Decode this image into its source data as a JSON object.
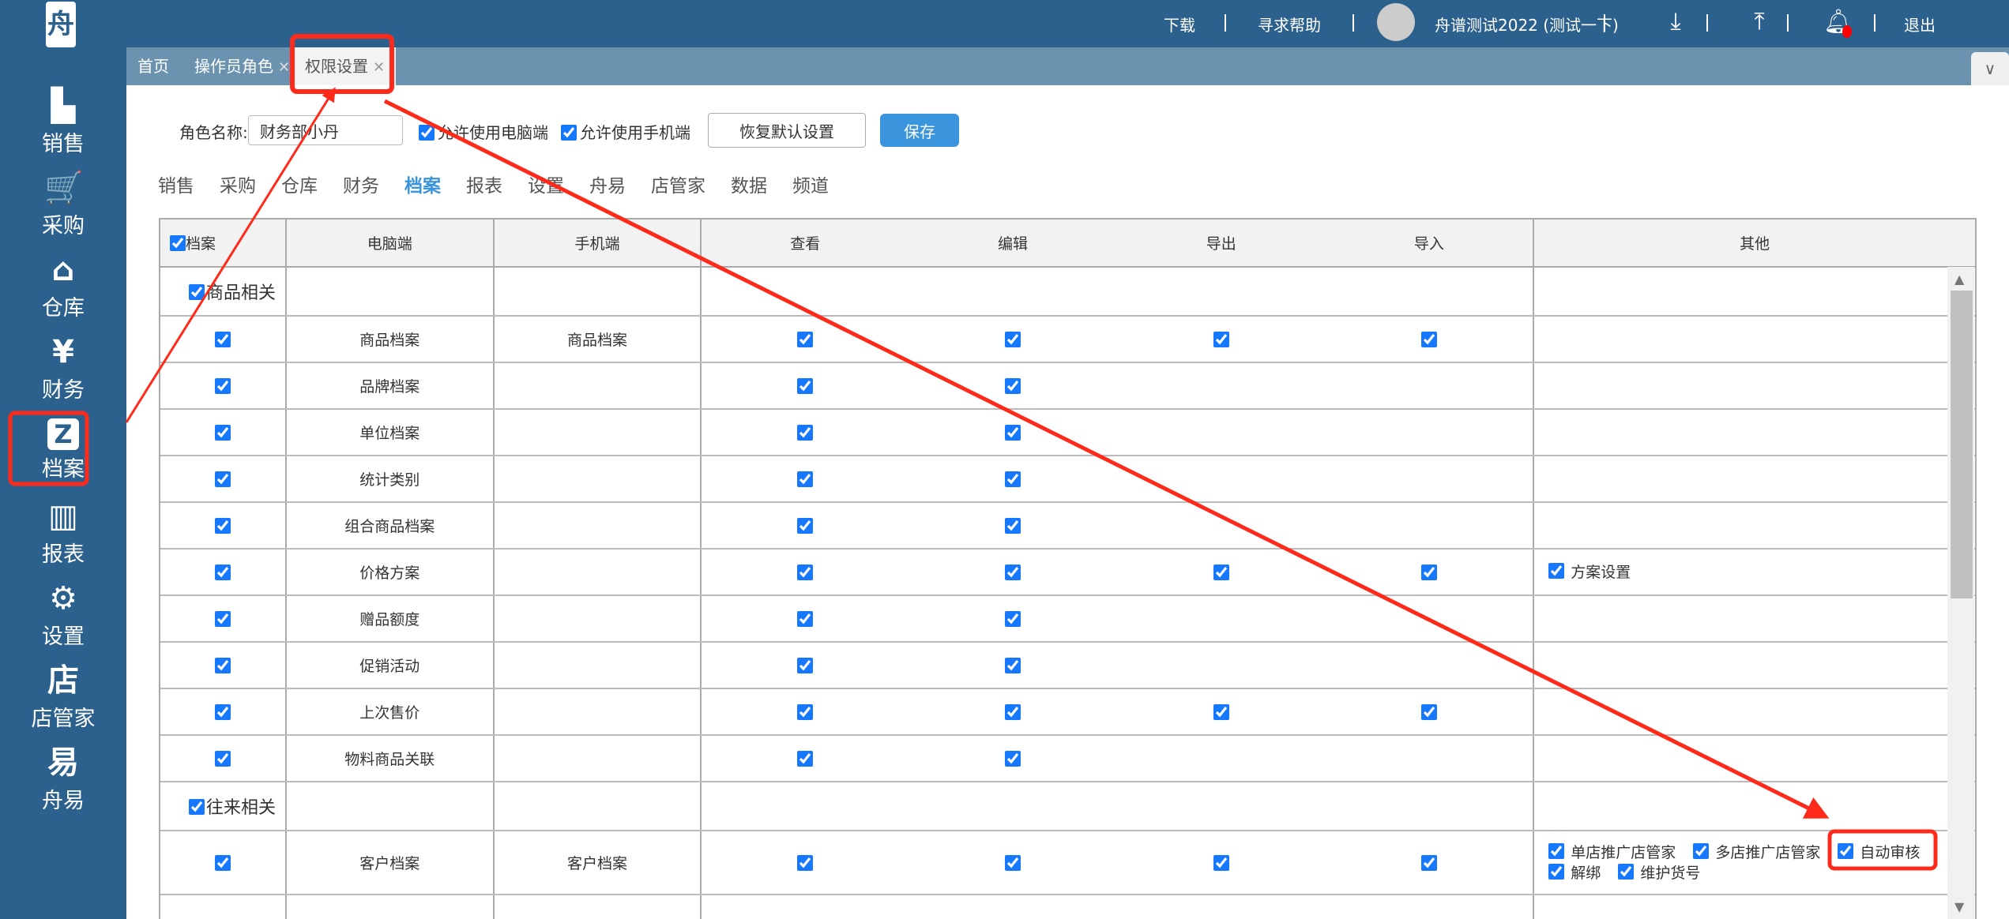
{
  "app": {
    "logo_text": "舟"
  },
  "topbar": {
    "download": "下载",
    "help": "寻求帮助",
    "user": "舟谱测试2022 (测试一下)",
    "logout": "退出",
    "notification_dot_color": "#ff0000"
  },
  "sidebar": {
    "active": "档案",
    "items": [
      {
        "label": "销售",
        "icon": "sales-chart-icon",
        "glyph": "▙"
      },
      {
        "label": "采购",
        "icon": "cart-icon",
        "glyph": "🛒"
      },
      {
        "label": "仓库",
        "icon": "warehouse-icon",
        "glyph": "⌂"
      },
      {
        "label": "财务",
        "icon": "yen-icon",
        "glyph": "¥"
      },
      {
        "label": "档案",
        "icon": "archive-z-icon",
        "glyph": "Z"
      },
      {
        "label": "报表",
        "icon": "report-bars-icon",
        "glyph": "▥"
      },
      {
        "label": "设置",
        "icon": "gear-icon",
        "glyph": "⚙"
      },
      {
        "label": "店管家",
        "icon": "store-icon",
        "glyph": "店"
      },
      {
        "label": "舟易",
        "icon": "zhouyi-icon",
        "glyph": "易"
      }
    ]
  },
  "tabs": [
    {
      "label": "首页",
      "closable": false
    },
    {
      "label": "操作员角色",
      "closable": true
    },
    {
      "label": "权限设置",
      "closable": true,
      "active": true
    }
  ],
  "form": {
    "role_label": "角色名称:",
    "role_value": "财务部小丹",
    "allow_pc": {
      "label": "允许使用电脑端",
      "checked": true
    },
    "allow_mobile": {
      "label": "允许使用手机端",
      "checked": true
    },
    "reset_label": "恢复默认设置",
    "save_label": "保存"
  },
  "categories": [
    "销售",
    "采购",
    "仓库",
    "财务",
    "档案",
    "报表",
    "设置",
    "舟易",
    "店管家",
    "数据",
    "频道"
  ],
  "active_category": "档案",
  "table": {
    "headers": {
      "all": "档案",
      "pc": "电脑端",
      "mobile": "手机端",
      "view": "查看",
      "edit": "编辑",
      "export": "导出",
      "import": "导入",
      "other": "其他"
    },
    "header_all_checked": true,
    "groups": [
      {
        "label": "商品相关",
        "checked": true,
        "rows": [
          {
            "pc": "商品档案",
            "mobile": "商品档案",
            "view": true,
            "edit": true,
            "export": true,
            "import": true,
            "other": []
          },
          {
            "pc": "品牌档案",
            "mobile": "",
            "view": true,
            "edit": true,
            "export": false,
            "import": false,
            "other": []
          },
          {
            "pc": "单位档案",
            "mobile": "",
            "view": true,
            "edit": true,
            "export": false,
            "import": false,
            "other": []
          },
          {
            "pc": "统计类别",
            "mobile": "",
            "view": true,
            "edit": true,
            "export": false,
            "import": false,
            "other": []
          },
          {
            "pc": "组合商品档案",
            "mobile": "",
            "view": true,
            "edit": true,
            "export": false,
            "import": false,
            "other": []
          },
          {
            "pc": "价格方案",
            "mobile": "",
            "view": true,
            "edit": true,
            "export": true,
            "import": true,
            "other": [
              {
                "label": "方案设置",
                "checked": true
              }
            ]
          },
          {
            "pc": "赠品额度",
            "mobile": "",
            "view": true,
            "edit": true,
            "export": false,
            "import": false,
            "other": []
          },
          {
            "pc": "促销活动",
            "mobile": "",
            "view": true,
            "edit": true,
            "export": false,
            "import": false,
            "other": []
          },
          {
            "pc": "上次售价",
            "mobile": "",
            "view": true,
            "edit": true,
            "export": true,
            "import": true,
            "other": []
          },
          {
            "pc": "物料商品关联",
            "mobile": "",
            "view": true,
            "edit": true,
            "export": false,
            "import": false,
            "other": []
          }
        ]
      },
      {
        "label": "往来相关",
        "checked": true,
        "rows": [
          {
            "pc": "客户档案",
            "mobile": "客户档案",
            "view": true,
            "edit": true,
            "export": true,
            "import": true,
            "tall": true,
            "other": [
              {
                "label": "单店推广店管家",
                "checked": true
              },
              {
                "label": "多店推广店管家",
                "checked": true
              },
              {
                "label": "自动审核",
                "checked": true
              },
              {
                "label": "解绑",
                "checked": true
              },
              {
                "label": "维护货号",
                "checked": true
              }
            ]
          }
        ]
      }
    ]
  },
  "annotation_color": "#ff2a1a"
}
